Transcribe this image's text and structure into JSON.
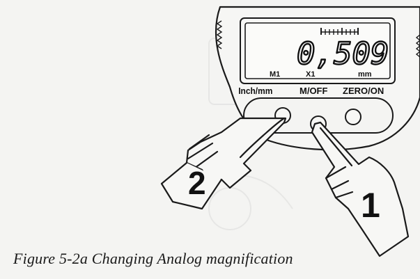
{
  "display": {
    "reading": "0,509",
    "memory_indicator": "M1",
    "magnification_indicator": "X1",
    "unit_indicator": "mm"
  },
  "buttons": {
    "inch_mm_label": "Inch/mm",
    "m_off_label": "M/OFF",
    "zero_on_label": "ZERO/ON"
  },
  "hands": {
    "left_number": "2",
    "right_number": "1"
  },
  "caption": "Figure 5-2a Changing Analog magnification"
}
